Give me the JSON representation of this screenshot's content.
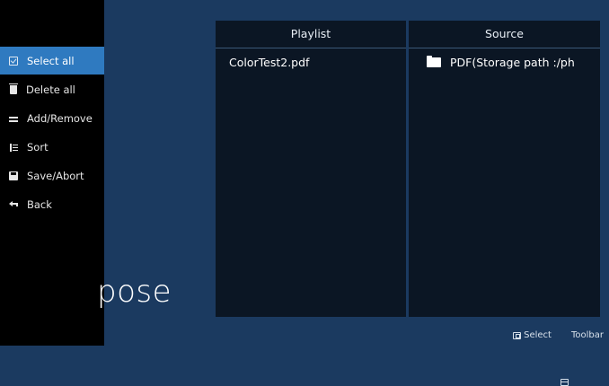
{
  "toolbar": {
    "items": [
      {
        "label": "Select all",
        "icon": "checkbox-icon",
        "selected": true
      },
      {
        "label": "Delete all",
        "icon": "trash-icon",
        "selected": false
      },
      {
        "label": "Add/Remove",
        "icon": "add-remove-icon",
        "selected": false
      },
      {
        "label": "Sort",
        "icon": "sort-icon",
        "selected": false
      },
      {
        "label": "Save/Abort",
        "icon": "save-icon",
        "selected": false
      },
      {
        "label": "Back",
        "icon": "back-icon",
        "selected": false
      }
    ]
  },
  "background_text": "pose",
  "playlist": {
    "header": "Playlist",
    "items": [
      "ColorTest2.pdf"
    ]
  },
  "source": {
    "header": "Source",
    "items": [
      {
        "label": "PDF(Storage path :/ph",
        "icon": "folder-icon"
      }
    ]
  },
  "hints": {
    "select_label": "Select",
    "toolbar_label": "Toolbar"
  },
  "colors": {
    "background": "#1b3a60",
    "toolbar": "#000000",
    "selected": "#2f7ac0",
    "panel": "#0b1624"
  }
}
